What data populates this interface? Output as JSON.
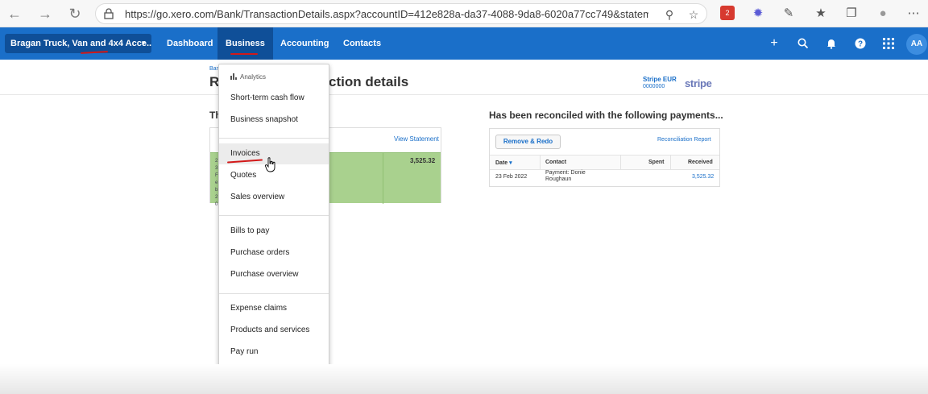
{
  "browser": {
    "url": "https://go.xero.com/Bank/TransactionDetails.aspx?accountID=412e828a-da37-4088-9da8-6020a77cc749&statementLineID...",
    "ext_badge": "2"
  },
  "nav": {
    "org_name": "Bragan Truck, Van and 4x4 Acce...",
    "items": [
      "Dashboard",
      "Business",
      "Accounting",
      "Contacts"
    ],
    "avatar": "AA",
    "accent": "#1a6fc9"
  },
  "page": {
    "breadcrumb": "Ban",
    "title": "R                            ction details",
    "title_visible_left": "R",
    "title_visible_right": "ction details",
    "bank_name": "Stripe EUR",
    "bank_number": "0000000",
    "bank_logo": "stripe"
  },
  "statement": {
    "section_title_partial": "Th",
    "view_statement": "View Statement",
    "amount": "3,525.32",
    "side_text": "2 3 F e b 2 0"
  },
  "reconciled": {
    "section_title": "Has been reconciled with the following payments...",
    "remove_redo": "Remove & Redo",
    "report_link": "Reconciliation Report",
    "columns": [
      "Date",
      "Contact",
      "Spent",
      "Received"
    ],
    "rows": [
      {
        "date": "23 Feb 2022",
        "contact_line1": "Payment: Donie",
        "contact_line2": "Roughaun",
        "spent": "",
        "received": "3,525.32"
      }
    ]
  },
  "menu": {
    "section_label": "Analytics",
    "group1": [
      "Short-term cash flow",
      "Business snapshot"
    ],
    "group2": [
      "Invoices",
      "Quotes",
      "Sales overview"
    ],
    "group3": [
      "Bills to pay",
      "Purchase orders",
      "Purchase overview"
    ],
    "group4": [
      "Expense claims",
      "Products and services",
      "Pay run"
    ]
  }
}
